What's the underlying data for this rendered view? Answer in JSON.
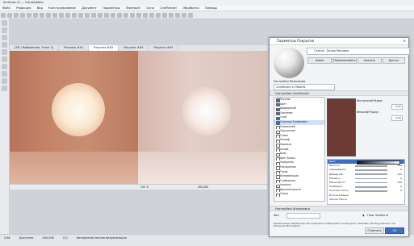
{
  "window": {
    "title": "Archicad 21 — Visualization"
  },
  "menu": [
    "Файл",
    "Редакция",
    "Вид",
    "Конструирование",
    "Документ",
    "Параметры",
    "Teamwork",
    "Окно",
    "CineRender",
    "Обработка",
    "Помощь"
  ],
  "tabs": [
    "[3D / Выбранное, Этаж 1]",
    "Рисунок #01",
    "Рисунок #02",
    "Рисунок #03",
    "Рисунок #04"
  ],
  "status": {
    "left": "100 %",
    "right": "400,000",
    "bottom": [
      "2,6k",
      "Доступно",
      "400,000",
      "0,0",
      "Фотореалистичная визуализация"
    ]
  },
  "dialog": {
    "title": "Параметры Покрытия",
    "surface": "Стекло - Белая Матовая",
    "buttons": [
      "Новое",
      "Переименовать",
      "Удалить",
      "Доступ"
    ],
    "preview_label": "Настройки Механизма:",
    "preview_value": "CineRender от MAXON",
    "section_cinerender": "Настройки CineRender",
    "channels": [
      {
        "label": "Рисунок",
        "on": true
      },
      {
        "label": "Цвет",
        "on": true
      },
      {
        "label": "Диффузный",
        "on": true
      },
      {
        "label": "Свечение",
        "on": true
      },
      {
        "label": "Слой",
        "on": true
      },
      {
        "label": "Сложная Затемняем.",
        "on": true,
        "sel": true
      },
      {
        "label": "Отражение",
        "on": false
      },
      {
        "label": "Окружение",
        "on": false
      },
      {
        "label": "Туман",
        "on": false
      },
      {
        "label": "Рельеф",
        "on": false
      },
      {
        "label": "Нормаль",
        "on": false
      },
      {
        "label": "Альфа",
        "on": false
      },
      {
        "label": "Блик",
        "on": false
      },
      {
        "label": "Цвет Блика",
        "on": false
      },
      {
        "label": "Смещение",
        "on": false
      },
      {
        "label": "Распыление",
        "on": false
      },
      {
        "label": "Трава",
        "on": false
      },
      {
        "label": "Иллюминация",
        "on": false
      },
      {
        "label": "Глобальная",
        "on": false
      },
      {
        "label": "Аналоги",
        "on": false
      },
      {
        "label": "Дополнительно",
        "on": false
      },
      {
        "label": "Сцена",
        "on": false
      },
      {
        "label": "Ткань",
        "on": false
      }
    ],
    "swatch_color": "#6e3a34",
    "sliders": [
      {
        "label": "Внутренний Радиус",
        "value": "0,00"
      },
      {
        "label": "Внешний Радиус",
        "value": "0,00"
      }
    ],
    "props": [
      {
        "label": "Цвет",
        "value": "",
        "header": true
      },
      {
        "label": "Яркость",
        "value": "100"
      },
      {
        "label": "Смешивание",
        "value": "0"
      },
      {
        "label": "Диффузия",
        "value": "100"
      },
      {
        "label": "Размыть",
        "value": "0"
      },
      {
        "label": "Масштаб Сл.",
        "value": "100"
      },
      {
        "label": "Анимация",
        "value": "0"
      },
      {
        "label": "Контрастность",
        "value": "0"
      },
      {
        "label": "Использование",
        "value": ""
      },
      {
        "label": "Анализ Прозр.",
        "value": ""
      }
    ],
    "section_bottom": "Настройки Штриховки",
    "bottom_label": "Фон",
    "note": "Примечание: Параметры 3D-покрытия отображаются в Рисунке, Ниапийн, 3D-Окружении и на Рисунках 3D-модели.",
    "radio_label": "Геом. Элемента",
    "cancel": "Отменить",
    "ok": "OK"
  },
  "colors": {
    "accent": "#3c6fc2",
    "wall_left": "#c4846a",
    "wall_right": "#e3cec8"
  }
}
